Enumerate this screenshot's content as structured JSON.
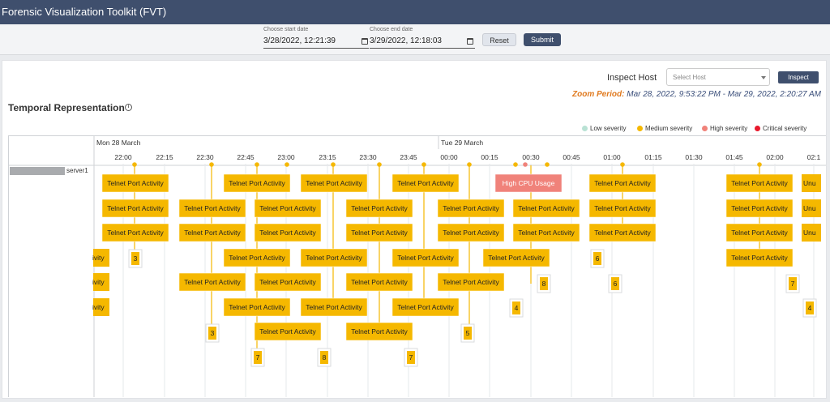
{
  "app": {
    "title": "Forensic Visualization Toolkit (FVT)"
  },
  "filters": {
    "start_label": "Choose start date",
    "start_value": "3/28/2022, 12:21:39",
    "end_label": "Choose end date",
    "end_value": "3/29/2022, 12:18:03",
    "reset_label": "Reset",
    "submit_label": "Submit"
  },
  "inspect": {
    "label": "Inspect Host",
    "select_placeholder": "Select Host",
    "button_label": "Inspect"
  },
  "zoom": {
    "label": "Zoom Period:",
    "value": "Mar 28, 2022, 9:53:22 PM - Mar 29, 2022, 2:20:27 AM"
  },
  "section_title": "Temporal Representation",
  "legend": [
    {
      "label": "Low severity",
      "color": "#b9e2d4"
    },
    {
      "label": "Medium severity",
      "color": "#f5b800"
    },
    {
      "label": "High severity",
      "color": "#f0827a"
    },
    {
      "label": "Critical severity",
      "color": "#e8192c"
    }
  ],
  "timeline": {
    "day_labels": [
      "Mon 28 March",
      "Tue 29 March"
    ],
    "ticks": [
      "22:00",
      "22:15",
      "22:30",
      "22:45",
      "23:00",
      "23:15",
      "23:30",
      "23:45",
      "00:00",
      "00:15",
      "00:30",
      "00:45",
      "01:00",
      "01:15",
      "01:30",
      "01:45",
      "02:00",
      "02:1"
    ],
    "host": "server1",
    "event_label": "Telnet Port Activity",
    "high_event_label": "High CPU Usage",
    "partial_left_label": "ivity",
    "partial_right_label": "Unu",
    "medium_color": "#f5b800",
    "high_color": "#f0827a",
    "critical_color": "#e8192c",
    "counts": [
      "3",
      "3",
      "7",
      "8",
      "7",
      "5",
      "4",
      "8",
      "6",
      "6",
      "7",
      "4"
    ]
  }
}
